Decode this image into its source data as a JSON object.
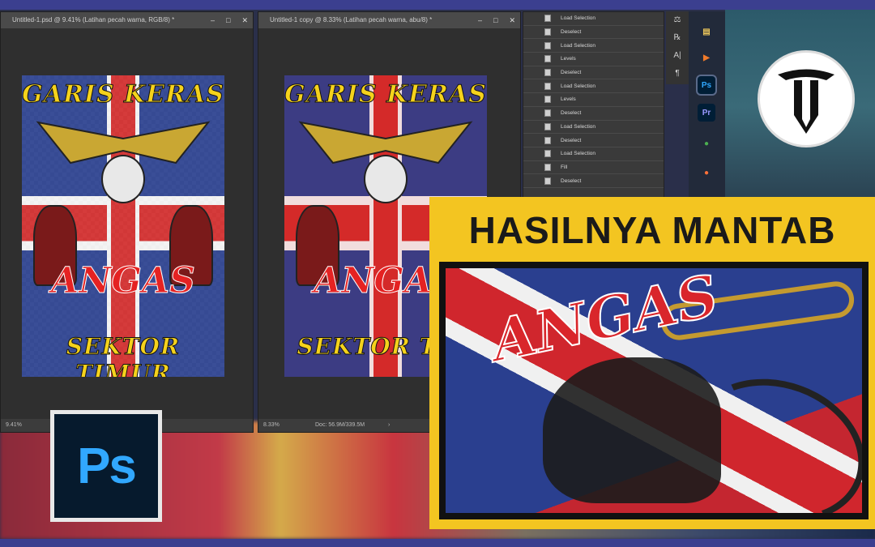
{
  "documents": [
    {
      "title": "Untitled-1.psd @ 9.41% (Latihan pecah warna, RGB/8) *",
      "zoom": "9.41%",
      "doc_size": "",
      "controls": [
        "–",
        "□",
        "✕"
      ],
      "poster": {
        "top_text": "GARIS KERAS",
        "brand_text": "ANGAS",
        "bottom_text": "SEKTOR TIMUR",
        "background": "transparent"
      }
    },
    {
      "title": "Untitled-1 copy @ 8.33% (Latihan pecah warna, abu/8) *",
      "zoom": "8.33%",
      "doc_size": "Doc: 56.9M/339.5M",
      "controls": [
        "–",
        "□",
        "✕"
      ],
      "poster": {
        "top_text": "GARIS KERAS",
        "brand_text": "ANGAS",
        "bottom_text": "SEKTOR TIM",
        "background": "#e8231e"
      }
    }
  ],
  "history_panel": {
    "items": [
      "Load Selection",
      "Deselect",
      "Load Selection",
      "Levels",
      "Deselect",
      "Load Selection",
      "Levels",
      "Deselect",
      "Load Selection",
      "Deselect",
      "Load Selection",
      "Fill",
      "Deselect"
    ]
  },
  "tool_column": [
    "⚖",
    "℞",
    "A|",
    "¶"
  ],
  "taskbar": {
    "apps": [
      {
        "name": "files-icon",
        "glyph": "▤",
        "color": "#e8c35a"
      },
      {
        "name": "media-player-icon",
        "glyph": "▶",
        "color": "#f07a2a"
      },
      {
        "name": "photoshop-icon",
        "glyph": "Ps",
        "color": "#31a8ff"
      },
      {
        "name": "premiere-icon",
        "glyph": "Pr",
        "color": "#9999ff"
      },
      {
        "name": "chrome-icon",
        "glyph": "●",
        "color": "#4caf50"
      },
      {
        "name": "firefox-icon",
        "glyph": "●",
        "color": "#ff7139"
      }
    ]
  },
  "channel_logo": "T",
  "ps_badge": "Ps",
  "result": {
    "title": "HASILNYA MANTAB",
    "fabric_text": "ANGAS"
  },
  "colors": {
    "accent_yellow": "#f3c521",
    "ps_blue": "#31a8ff",
    "flag_red": "#d0262d",
    "flag_blue": "#2a3f8f"
  }
}
